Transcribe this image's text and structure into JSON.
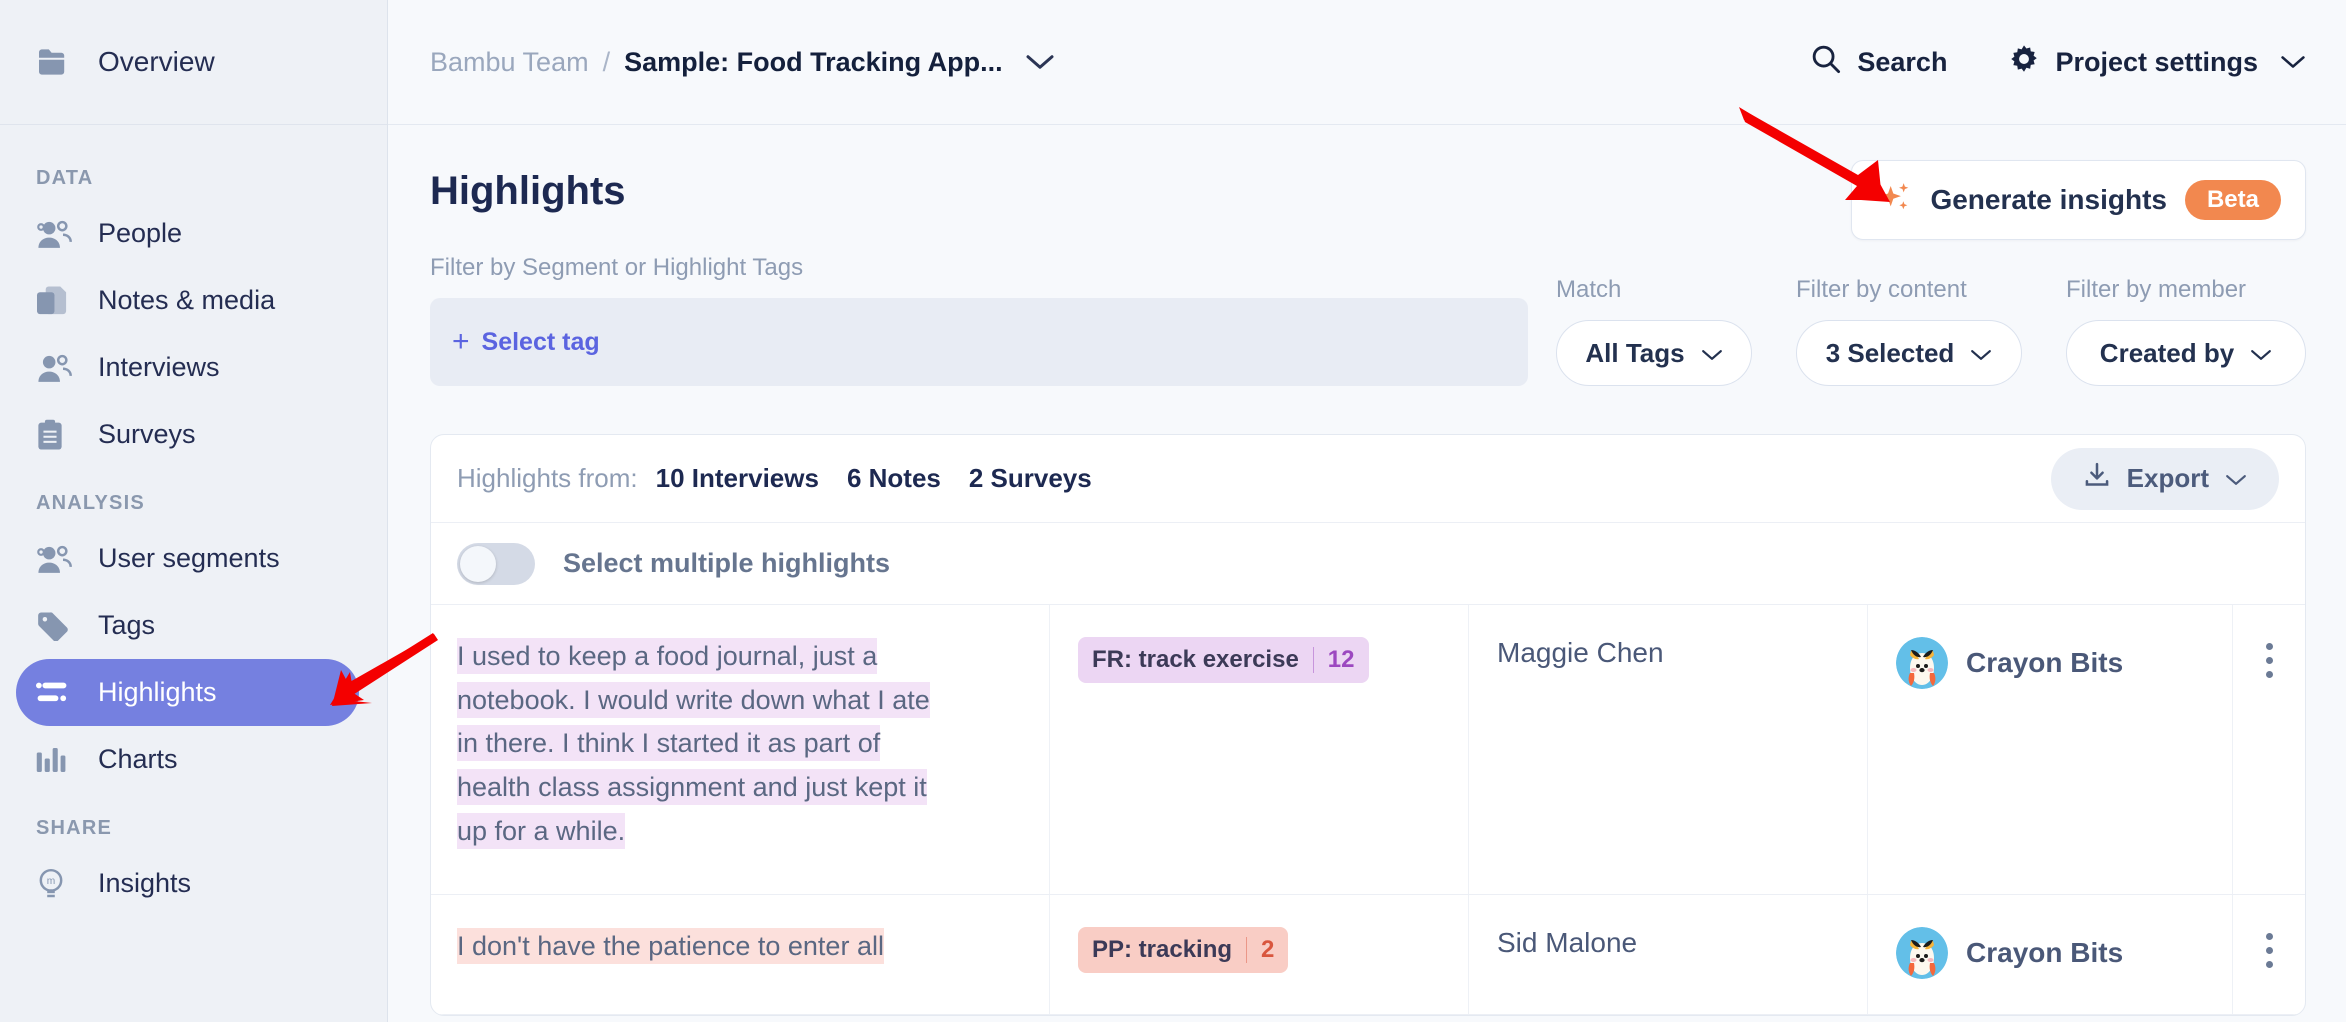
{
  "sidebar": {
    "overview": {
      "label": "Overview",
      "icon": "folder-icon"
    },
    "sections": [
      {
        "title": "DATA",
        "items": [
          {
            "label": "People",
            "icon": "people-icon"
          },
          {
            "label": "Notes & media",
            "icon": "notes-icon"
          },
          {
            "label": "Interviews",
            "icon": "interviews-icon"
          },
          {
            "label": "Surveys",
            "icon": "clipboard-icon"
          }
        ]
      },
      {
        "title": "ANALYSIS",
        "items": [
          {
            "label": "User segments",
            "icon": "people-icon"
          },
          {
            "label": "Tags",
            "icon": "tag-icon"
          },
          {
            "label": "Highlights",
            "icon": "highlights-icon",
            "active": true
          },
          {
            "label": "Charts",
            "icon": "bar-chart-icon"
          }
        ]
      },
      {
        "title": "SHARE",
        "items": [
          {
            "label": "Insights",
            "icon": "lightbulb-icon"
          }
        ]
      }
    ]
  },
  "topbar": {
    "team": "Bambu Team",
    "separator": "/",
    "project": "Sample: Food Tracking App...",
    "search_label": "Search",
    "project_settings_label": "Project settings"
  },
  "generate_insights": {
    "label": "Generate insights",
    "badge": "Beta",
    "badge_color": "#f2884f"
  },
  "page": {
    "title": "Highlights"
  },
  "filters": {
    "tag_filter_label": "Filter by Segment or Highlight Tags",
    "select_tag_label": "Select tag",
    "match_label": "Match",
    "match_value": "All Tags",
    "content_label": "Filter by content",
    "content_value": "3 Selected",
    "member_label": "Filter by member",
    "member_value": "Created by"
  },
  "card": {
    "highlights_from_label": "Highlights from:",
    "sources": [
      "10 Interviews",
      "6 Notes",
      "2 Surveys"
    ],
    "export_label": "Export",
    "select_multiple_label": "Select multiple highlights"
  },
  "rows": [
    {
      "quote_lines": [
        "I used to keep a food journal, just a",
        "notebook. I would write down what I ate",
        "in there. I think I started it as part of",
        "health class assignment and just kept it",
        "up for a while."
      ],
      "highlight_color": "purple",
      "tag": {
        "name": "FR: track exercise",
        "count": "12",
        "color": "purple"
      },
      "participant": "Maggie Chen",
      "owner": "Crayon Bits"
    },
    {
      "quote_lines": [
        "I don't have the patience to enter all"
      ],
      "highlight_color": "red",
      "tag": {
        "name": "PP: tracking",
        "count": "2",
        "color": "red"
      },
      "participant": "Sid Malone",
      "owner": "Crayon Bits"
    }
  ],
  "annotations": {
    "arrow_1": "points-to-generate-insights-button",
    "arrow_2": "points-to-highlights-sidebar-item",
    "color": "#f40000"
  }
}
